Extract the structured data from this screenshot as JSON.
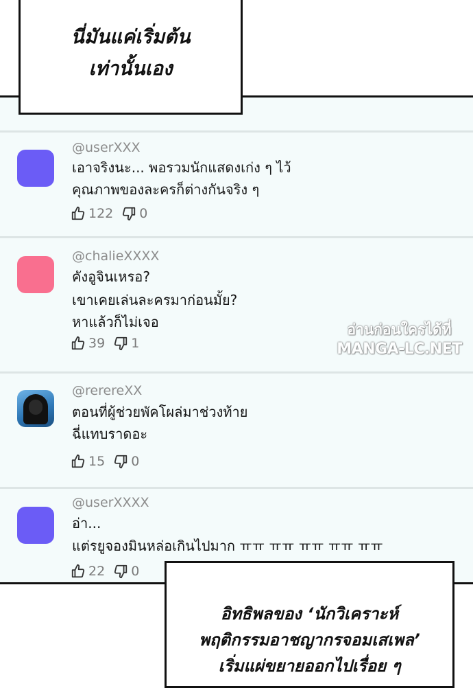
{
  "bubbles": {
    "top_line1": "นี่มันแค่เริ่มต้น",
    "top_line2": "เท่านั้นเอง",
    "bottom_line1": "อิทธิพลของ ‘นักวิเคราะห์",
    "bottom_line2": "พฤติกรรมอาชญากรจอมเสเพล’",
    "bottom_line3": "เริ่มแผ่ขยายออกไปเรื่อย ๆ"
  },
  "watermark": {
    "line1": "อ่านก่อนใครได้ที่",
    "line2": "MANGA-LC.NET"
  },
  "comments": [
    {
      "user": "@userXXX",
      "lines": [
        "เอาจริงนะ... พอรวมนักแสดงเก่ง ๆ ไว้",
        "คุณภาพของละครก็ต่างกันจริง ๆ"
      ],
      "likes": "122",
      "dislikes": "0",
      "avatar_color": "#6b5cf6",
      "avatar_icon": "purple-square-avatar"
    },
    {
      "user": "@chalieXXXX",
      "lines": [
        "คังอูจินเหรอ?",
        "เขาเคยเล่นละครมาก่อนมั้ย?",
        "หาแล้วก็ไม่เจอ"
      ],
      "likes": "39",
      "dislikes": "1",
      "avatar_color": "#f96f8f",
      "avatar_icon": "pink-square-avatar"
    },
    {
      "user": "@rerereXX",
      "lines": [
        "ตอนที่ผู้ช่วยพัคโผล่มาช่วงท้าย",
        "ฉี่แทบราดอะ"
      ],
      "likes": "15",
      "dislikes": "0",
      "avatar_color": "#2f79b8",
      "avatar_icon": "hooded-figure-avatar"
    },
    {
      "user": "@userXXXX",
      "lines": [
        "อ่า...",
        "แต่รยูจองมินหล่อเกินไปมาก ㅠㅠ ㅠㅠ ㅠㅠ ㅠㅠ ㅠㅠ"
      ],
      "likes": "22",
      "dislikes": "0",
      "avatar_color": "#6b5cf6",
      "avatar_icon": "purple-square-avatar"
    }
  ]
}
